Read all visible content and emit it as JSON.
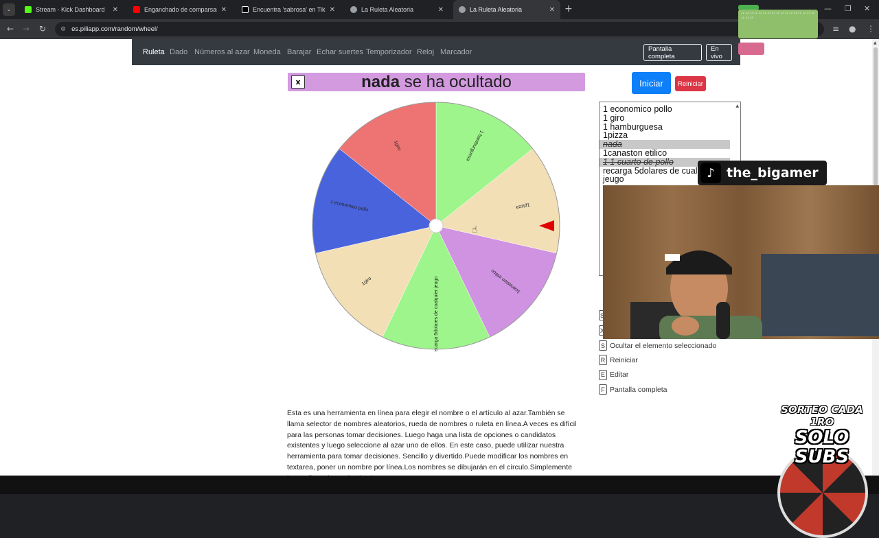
{
  "browser": {
    "tabs": [
      {
        "label": "Stream - Kick Dashboard",
        "favicon_color": "#53fc18"
      },
      {
        "label": "Enganchado de comparsas con",
        "favicon_color": "#ff0000"
      },
      {
        "label": "Encuentra 'sabrosa' en TikTok |",
        "favicon_color": "#ffffff"
      },
      {
        "label": "La Ruleta Aleatoria",
        "favicon_color": "#9aa0a6"
      },
      {
        "label": "La Ruleta Aleatoria",
        "favicon_color": "#9aa0a6"
      }
    ],
    "tab_close_glyph": "✕",
    "newtab_glyph": "+",
    "url": "es.piliapp.com/random/wheel/"
  },
  "site_nav": {
    "items": [
      "Ruleta",
      "Dado",
      "Números al azar",
      "Moneda",
      "Barajar",
      "Echar suertes",
      "Temporizador",
      "Reloj",
      "Marcador"
    ],
    "fullscreen_label": "Pantalla completa",
    "live_label": "En vivo"
  },
  "banner": {
    "close_label": "x",
    "hidden_item": "nada",
    "hidden_suffix": " se ha ocultado"
  },
  "controls": {
    "start_label": "Iniciar",
    "reset_label": "Reiniciar"
  },
  "wheel": {
    "segments": [
      {
        "label": "1 hamburguesa",
        "color": "#9ef58b"
      },
      {
        "label": "1pizza",
        "color": "#f2dfb6"
      },
      {
        "label": "1canaston etilico",
        "color": "#cf93e2"
      },
      {
        "label": "recarga 5dolares de cualquier jeugo",
        "color": "#9ef58b"
      },
      {
        "label": "1giro",
        "color": "#f2dfb6"
      },
      {
        "label": "1 economico pollo",
        "color": "#4963dc"
      },
      {
        "label": "1giro",
        "color": "#ee7474"
      }
    ],
    "pointer_color": "#e00000"
  },
  "entries": {
    "lines": [
      {
        "text": "1 economico pollo",
        "hidden": false
      },
      {
        "text": "1 giro",
        "hidden": false
      },
      {
        "text": "1 hamburguesa",
        "hidden": false
      },
      {
        "text": "1pizza",
        "hidden": false
      },
      {
        "text": "nada",
        "hidden": true
      },
      {
        "text": "1canaston etilico",
        "hidden": false
      },
      {
        "text": "1 1 cuarto de pollo",
        "hidden": true
      },
      {
        "text": "recarga 5dolares de cualquier",
        "hidden": false
      },
      {
        "text": "jeugo",
        "hidden": false
      }
    ]
  },
  "shortcuts": [
    {
      "key": "S",
      "label": "Ocultar el elemento seleccionado"
    },
    {
      "key": "R",
      "label": "Reiniciar"
    },
    {
      "key": "E",
      "label": "Editar"
    },
    {
      "key": "F",
      "label": "Pantalla completa"
    }
  ],
  "side_keys": [
    "S",
    "X"
  ],
  "description": "Esta es una herramienta en línea para elegir el nombre o el artículo al azar.También se llama selector de nombres aleatorios, rueda de nombres o ruleta en línea.A veces es difícil para las personas tomar decisiones. Luego haga una lista de opciones o candidatos existentes y luego seleccione al azar uno de ellos. En este caso, puede utilizar nuestra herramienta para tomar decisiones. Sencillo y divertido.Puede modificar los nombres en textarea, poner un nombre por línea.Los nombres se dibujarán en el círculo.Simplemente haga clic en la rueda circular,",
  "overlay": {
    "tiktok_logo": "♪",
    "tiktok_name": "the_bigamer",
    "promo_line1": "SORTEO CADA 1RO",
    "promo_line2": "SOLO SUBS"
  }
}
